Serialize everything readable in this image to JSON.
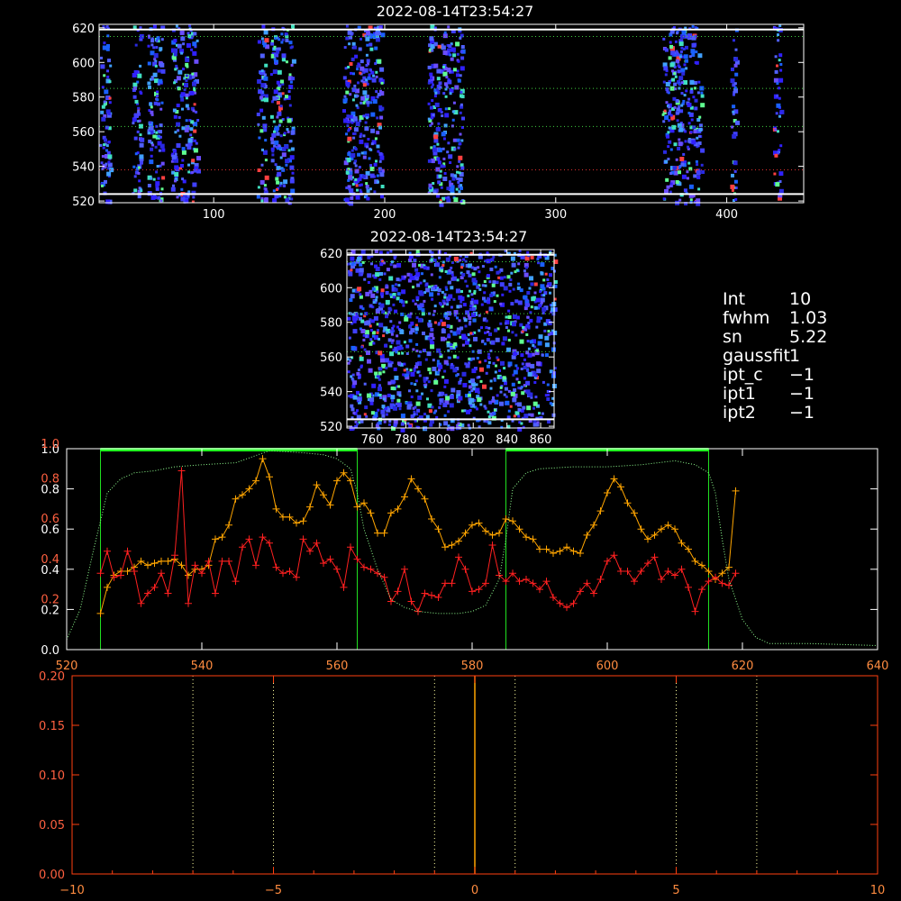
{
  "panels": {
    "top": {
      "title": "2022-08-14T23:54:27",
      "xlim": [
        33,
        445
      ],
      "ylim": [
        519,
        622
      ],
      "xticks": [
        100,
        200,
        300,
        400
      ],
      "yticks": [
        520,
        540,
        560,
        580,
        600,
        620
      ],
      "white_lines": [
        524,
        619
      ],
      "green_dotted": [
        563,
        585,
        615
      ],
      "red_dotted": [
        538
      ],
      "bands": [
        [
          33,
          39
        ],
        [
          52,
          57
        ],
        [
          61,
          70
        ],
        [
          75,
          90
        ],
        [
          125,
          130
        ],
        [
          133,
          146
        ],
        [
          175,
          198
        ],
        [
          225,
          245
        ],
        [
          362,
          385
        ],
        [
          402,
          405
        ],
        [
          427,
          431
        ]
      ]
    },
    "middle": {
      "title": "2022-08-14T23:54:27",
      "xlim": [
        745,
        868
      ],
      "ylim": [
        519,
        622
      ],
      "xticks": [
        760,
        780,
        800,
        820,
        840,
        860
      ],
      "yticks": [
        520,
        540,
        560,
        580,
        600,
        620
      ],
      "white_lines": [
        524,
        619
      ],
      "green_dotted": [
        563,
        585,
        615
      ]
    },
    "profile": {
      "xlim": [
        520,
        640
      ],
      "ylim": [
        0.0,
        1.0
      ],
      "xticks": [
        520,
        540,
        560,
        580,
        600,
        620,
        640
      ],
      "ytick_labels_white": [
        "0.0",
        "0.2",
        "0.4",
        "0.6",
        "0.8",
        "1.0"
      ],
      "ytick_labels_red": [
        "0.2",
        "0.4",
        "0.6",
        "0.8",
        "1.0"
      ],
      "green_boxes": [
        [
          525,
          563
        ],
        [
          585,
          615
        ]
      ]
    },
    "bottom": {
      "xlim": [
        -10,
        10
      ],
      "ylim": [
        0.0,
        0.2
      ],
      "xticks": [
        "−10",
        "−5",
        "0",
        "5",
        "10"
      ],
      "yticks": [
        "0.00",
        "0.05",
        "0.10",
        "0.15",
        "0.20"
      ],
      "vlines_dotted": [
        -7,
        -5,
        -1,
        1,
        5,
        7
      ],
      "orange_line_x": 0
    }
  },
  "info": [
    {
      "key": "Int",
      "value": "10"
    },
    {
      "key": "fwhm",
      "value": "1.03"
    },
    {
      "key": "sn",
      "value": "5.22"
    },
    {
      "key": "gaussfit",
      "value": "1"
    },
    {
      "key": "ipt_c",
      "value": "−1"
    },
    {
      "key": "ipt1",
      "value": "−1"
    },
    {
      "key": "ipt2",
      "value": "−1"
    }
  ],
  "chart_data": [
    {
      "type": "line",
      "series": [
        {
          "color": "#ffa500",
          "x": [
            525,
            526,
            527,
            528,
            529,
            530,
            531,
            532,
            533,
            534,
            535,
            536,
            537,
            538,
            539,
            540,
            541,
            542,
            543,
            544,
            545,
            546,
            547,
            548,
            549,
            550,
            551,
            552,
            553,
            554,
            555,
            556,
            557,
            558,
            559,
            560,
            561,
            562,
            563,
            564,
            565,
            566,
            567,
            568,
            569,
            570,
            571,
            572,
            573,
            574,
            575,
            576,
            577,
            578,
            579,
            580,
            581,
            582,
            583,
            584,
            585,
            586,
            587,
            588,
            589,
            590,
            591,
            592,
            593,
            594,
            595,
            596,
            597,
            598,
            599,
            600,
            601,
            602,
            603,
            604,
            605,
            606,
            607,
            608,
            609,
            610,
            611,
            612,
            613,
            614,
            615,
            616,
            617,
            618,
            619
          ],
          "y": [
            0.18,
            0.31,
            0.37,
            0.39,
            0.39,
            0.41,
            0.44,
            0.42,
            0.43,
            0.44,
            0.44,
            0.45,
            0.42,
            0.37,
            0.4,
            0.4,
            0.42,
            0.55,
            0.56,
            0.62,
            0.75,
            0.77,
            0.8,
            0.84,
            0.95,
            0.86,
            0.7,
            0.66,
            0.66,
            0.63,
            0.64,
            0.71,
            0.82,
            0.77,
            0.72,
            0.84,
            0.88,
            0.84,
            0.71,
            0.73,
            0.68,
            0.58,
            0.58,
            0.68,
            0.7,
            0.76,
            0.85,
            0.8,
            0.75,
            0.65,
            0.6,
            0.51,
            0.52,
            0.54,
            0.58,
            0.62,
            0.63,
            0.59,
            0.57,
            0.58,
            0.65,
            0.64,
            0.6,
            0.56,
            0.55,
            0.5,
            0.5,
            0.48,
            0.49,
            0.51,
            0.49,
            0.48,
            0.57,
            0.62,
            0.69,
            0.78,
            0.85,
            0.81,
            0.73,
            0.68,
            0.6,
            0.55,
            0.57,
            0.6,
            0.62,
            0.6,
            0.53,
            0.5,
            0.44,
            0.42,
            0.39,
            0.35,
            0.38,
            0.41,
            0.79
          ]
        },
        {
          "color": "#ff2020",
          "x": [
            525,
            526,
            527,
            528,
            529,
            530,
            531,
            532,
            533,
            534,
            535,
            536,
            537,
            538,
            539,
            540,
            541,
            542,
            543,
            544,
            545,
            546,
            547,
            548,
            549,
            550,
            551,
            552,
            553,
            554,
            555,
            556,
            557,
            558,
            559,
            560,
            561,
            562,
            563,
            564,
            565,
            566,
            567,
            568,
            569,
            570,
            571,
            572,
            573,
            574,
            575,
            576,
            577,
            578,
            579,
            580,
            581,
            582,
            583,
            584,
            585,
            586,
            587,
            588,
            589,
            590,
            591,
            592,
            593,
            594,
            595,
            596,
            597,
            598,
            599,
            600,
            601,
            602,
            603,
            604,
            605,
            606,
            607,
            608,
            609,
            610,
            611,
            612,
            613,
            614,
            615,
            616,
            617,
            618,
            619
          ],
          "y": [
            0.38,
            0.49,
            0.36,
            0.37,
            0.49,
            0.39,
            0.23,
            0.28,
            0.31,
            0.38,
            0.28,
            0.47,
            0.89,
            0.23,
            0.42,
            0.38,
            0.44,
            0.28,
            0.44,
            0.44,
            0.34,
            0.51,
            0.55,
            0.42,
            0.56,
            0.53,
            0.41,
            0.38,
            0.39,
            0.36,
            0.55,
            0.49,
            0.53,
            0.43,
            0.45,
            0.4,
            0.31,
            0.51,
            0.45,
            0.41,
            0.4,
            0.38,
            0.36,
            0.24,
            0.29,
            0.4,
            0.24,
            0.19,
            0.28,
            0.27,
            0.26,
            0.33,
            0.33,
            0.46,
            0.4,
            0.29,
            0.3,
            0.33,
            0.52,
            0.37,
            0.34,
            0.38,
            0.34,
            0.35,
            0.33,
            0.3,
            0.34,
            0.26,
            0.23,
            0.21,
            0.23,
            0.29,
            0.33,
            0.28,
            0.35,
            0.44,
            0.47,
            0.39,
            0.39,
            0.34,
            0.39,
            0.43,
            0.46,
            0.35,
            0.39,
            0.37,
            0.4,
            0.31,
            0.19,
            0.3,
            0.34,
            0.36,
            0.33,
            0.32,
            0.38
          ]
        },
        {
          "color": "#90ff90",
          "dashed": true,
          "x": [
            520,
            522,
            524,
            526,
            528,
            530,
            533,
            536,
            540,
            545,
            550,
            555,
            558,
            560,
            562,
            563,
            564,
            566,
            568,
            570,
            572,
            575,
            578,
            580,
            582,
            584,
            585,
            586,
            588,
            590,
            595,
            600,
            605,
            610,
            613,
            615,
            616,
            617,
            618,
            620,
            622,
            624,
            630,
            640
          ],
          "y": [
            0.05,
            0.2,
            0.5,
            0.78,
            0.85,
            0.88,
            0.89,
            0.91,
            0.92,
            0.93,
            0.99,
            0.98,
            0.97,
            0.95,
            0.9,
            0.78,
            0.6,
            0.4,
            0.25,
            0.21,
            0.19,
            0.18,
            0.18,
            0.19,
            0.22,
            0.35,
            0.55,
            0.8,
            0.88,
            0.9,
            0.91,
            0.91,
            0.92,
            0.94,
            0.92,
            0.88,
            0.78,
            0.55,
            0.35,
            0.15,
            0.06,
            0.03,
            0.03,
            0.02
          ]
        }
      ]
    },
    {
      "type": "line",
      "series": [
        {
          "color": "#ffa500",
          "x": [
            0,
            0
          ],
          "y": [
            0.0,
            0.2
          ]
        }
      ]
    }
  ]
}
